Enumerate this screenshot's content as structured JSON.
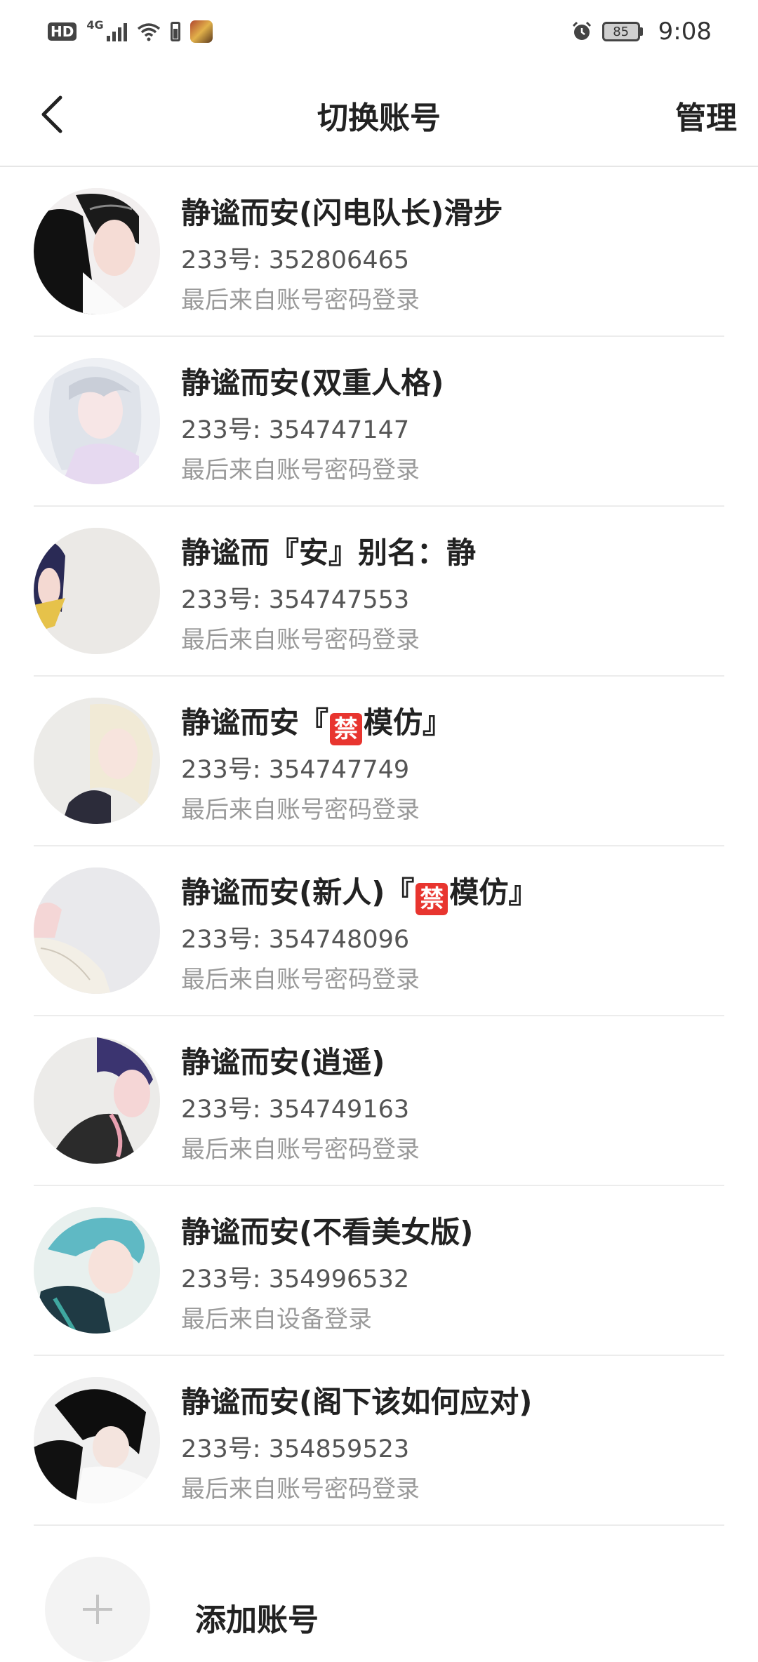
{
  "status_bar": {
    "hd": "HD",
    "network": "4G",
    "battery_level": "85",
    "time": "9:08"
  },
  "header": {
    "back_icon": "chevron-left-icon",
    "title": "切换账号",
    "manage": "管理"
  },
  "accounts": [
    {
      "name": "静谧而安(闪电队长)滑步",
      "id_text": "233号: 352806465",
      "login_text": "最后来自账号密码登录"
    },
    {
      "name": "静谧而安(双重人格)",
      "id_text": "233号: 354747147",
      "login_text": "最后来自账号密码登录"
    },
    {
      "name": "静谧而『安』别名：静",
      "id_text": "233号: 354747553",
      "login_text": "最后来自账号密码登录"
    },
    {
      "name_prefix": "静谧而安『",
      "badge": "禁",
      "name_suffix": "模仿』",
      "id_text": "233号: 354747749",
      "login_text": "最后来自账号密码登录"
    },
    {
      "name_prefix": "静谧而安(新人)『",
      "badge": "禁",
      "name_suffix": "模仿』",
      "id_text": "233号: 354748096",
      "login_text": "最后来自账号密码登录"
    },
    {
      "name": "静谧而安(逍遥)",
      "id_text": "233号: 354749163",
      "login_text": "最后来自账号密码登录"
    },
    {
      "name": "静谧而安(不看美女版)",
      "id_text": "233号: 354996532",
      "login_text": "最后来自设备登录"
    },
    {
      "name": "静谧而安(阁下该如何应对)",
      "id_text": "233号: 354859523",
      "login_text": "最后来自账号密码登录"
    }
  ],
  "add_account": {
    "icon": "plus-icon",
    "label": "添加账号"
  },
  "colors": {
    "badge_red": "#e8352f",
    "secondary_text": "#9a9a9a",
    "divider": "#ececec"
  }
}
